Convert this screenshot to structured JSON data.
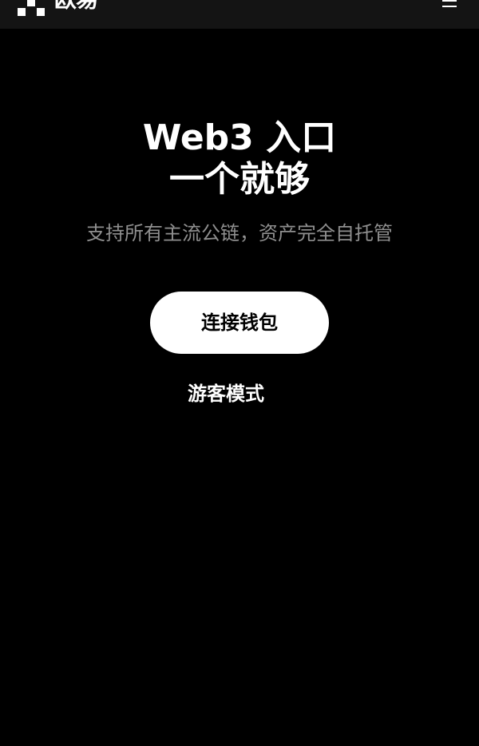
{
  "header": {
    "brand_name": "欧易",
    "logo_icon": "okx-logo-icon",
    "menu_icon": "hamburger-menu-icon"
  },
  "hero": {
    "title_line1": "Web3 入口",
    "title_line2": "一个就够",
    "subtitle": "支持所有主流公链，资产完全自托管"
  },
  "actions": {
    "connect_wallet_label": "连接钱包",
    "guest_mode_label": "游客模式"
  },
  "colors": {
    "background": "#000000",
    "topbar": "#141414",
    "primary_button": "#ffffff",
    "subtitle_text": "#8f8f8f"
  }
}
